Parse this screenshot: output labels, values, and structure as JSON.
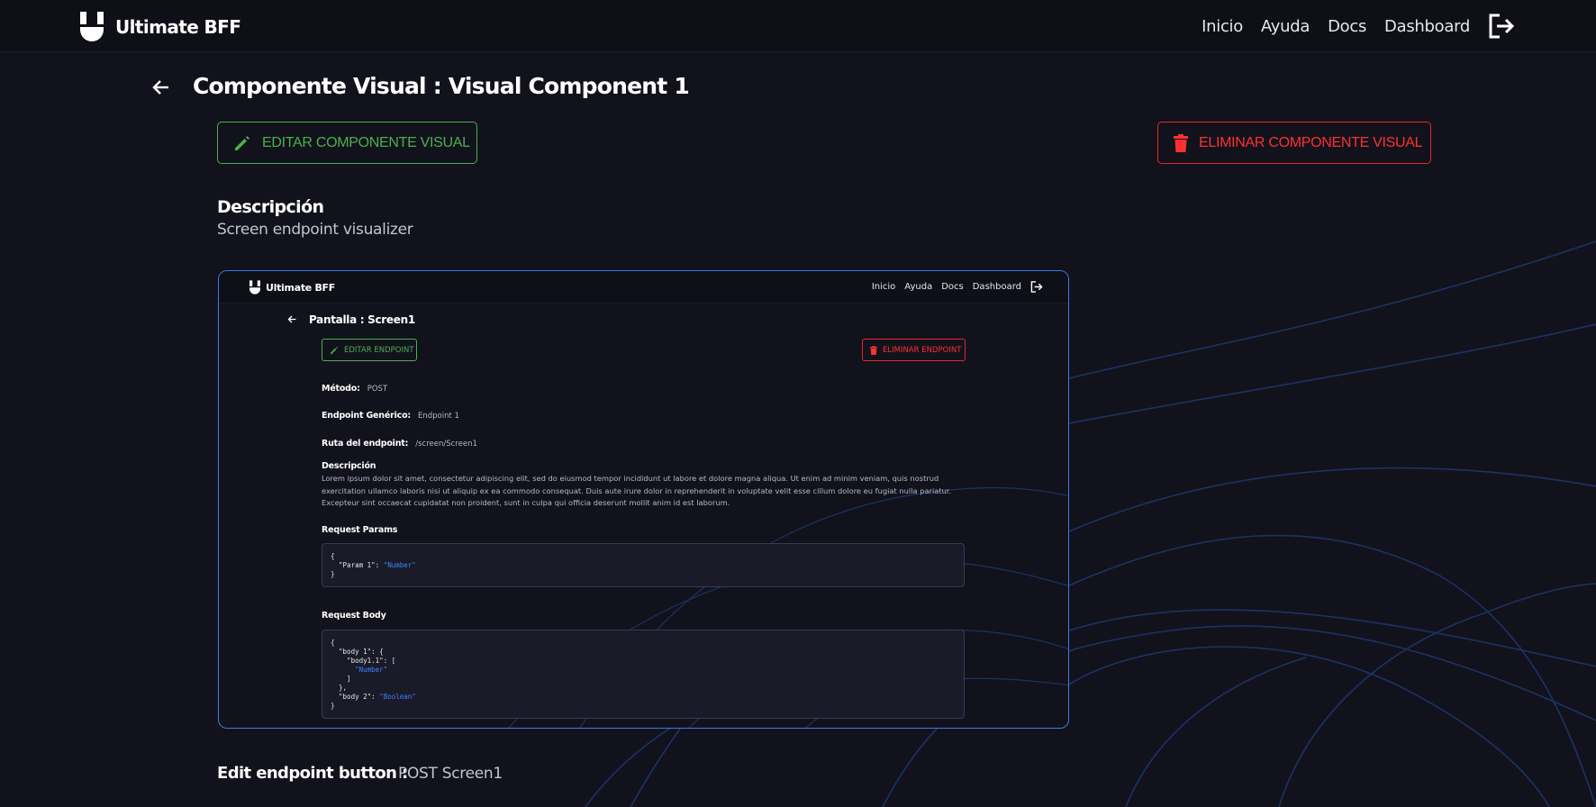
{
  "app": {
    "name": "Ultimate BFF",
    "nav": [
      "Inicio",
      "Ayuda",
      "Docs",
      "Dashboard"
    ]
  },
  "page": {
    "title": "Componente Visual : Visual Component 1",
    "edit_button": "EDITAR COMPONENTE VISUAL",
    "delete_button": "ELIMINAR COMPONENTE VISUAL",
    "description_heading": "Descripción",
    "description_text": "Screen endpoint visualizer",
    "edit_endpoint_label": "Edit endpoint button :",
    "edit_endpoint_value": "POST Screen1"
  },
  "preview": {
    "app_name": "Ultimate BFF",
    "nav": [
      "Inicio",
      "Ayuda",
      "Docs",
      "Dashboard"
    ],
    "title": "Pantalla : Screen1",
    "edit_button": "EDITAR ENDPOINT",
    "delete_button": "ELIMINAR ENDPOINT",
    "method_label": "Método:",
    "method_value": "POST",
    "generic_label": "Endpoint Genérico:",
    "generic_value": "Endpoint 1",
    "route_label": "Ruta del endpoint:",
    "route_value": "/screen/Screen1",
    "description_heading": "Descripción",
    "description_text": "Lorem ipsum dolor sit amet, consectetur adipiscing elit, sed do eiusmod tempor incididunt ut labore et dolore magna aliqua. Ut enim ad minim veniam, quis nostrud exercitation ullamco laboris nisi ut aliquip ex ea commodo consequat. Duis aute irure dolor in reprehenderit in voluptate velit esse cillum dolore eu fugiat nulla pariatur. Excepteur sint occaecat cupidatat non proident, sunt in culpa qui officia deserunt mollit anim id est laborum.",
    "params_heading": "Request Params",
    "params_lines": [
      "{",
      "  \"Param 1\": ",
      "}"
    ],
    "params_string": "\"Number\"",
    "body_heading": "Request Body",
    "body_lines": [
      "{",
      "  \"body 1\": {",
      "    \"body1.1\": [",
      "      ",
      "    ]",
      "  },",
      "  \"body 2\": ",
      "}"
    ],
    "body_string_1": "\"Number\"",
    "body_string_2": "\"Boolean\""
  },
  "colors": {
    "background": "#12121c",
    "edit_green": "#4ab04e",
    "delete_red": "#ff3030",
    "preview_border": "#3d7ae8",
    "code_string": "#3a86ff"
  },
  "icons": [
    "logo-u-icon",
    "logout-icon",
    "back-arrow-icon",
    "pencil-icon",
    "trash-icon"
  ]
}
